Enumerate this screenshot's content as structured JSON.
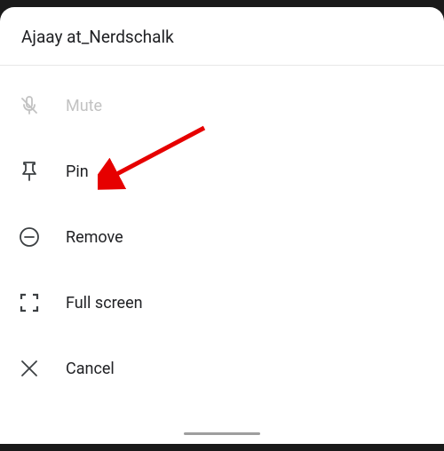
{
  "header": {
    "title": "Ajaay at_Nerdschalk"
  },
  "menu": {
    "mute": {
      "label": "Mute"
    },
    "pin": {
      "label": "Pin"
    },
    "remove": {
      "label": "Remove"
    },
    "fullscreen": {
      "label": "Full screen"
    },
    "cancel": {
      "label": "Cancel"
    }
  }
}
